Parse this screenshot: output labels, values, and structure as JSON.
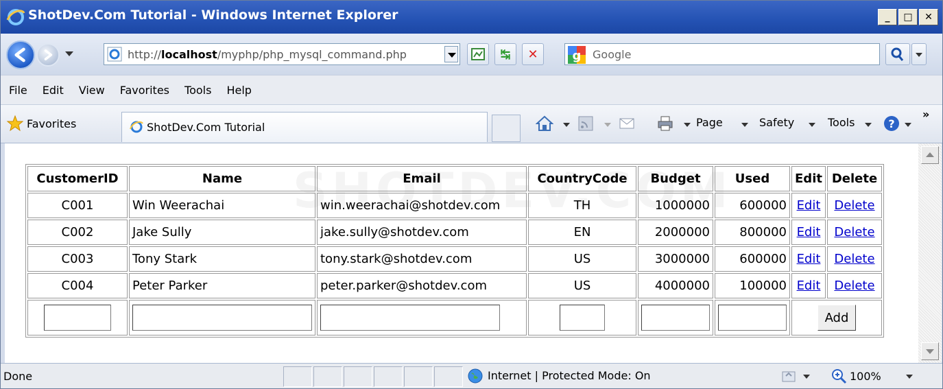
{
  "window": {
    "title": "ShotDev.Com Tutorial - Windows Internet Explorer",
    "controls": [
      "_",
      "□",
      "✕"
    ]
  },
  "address": {
    "prefix": "http://",
    "host": "localhost",
    "path": "/myphp/php_mysql_command.php"
  },
  "search": {
    "placeholder": "Google"
  },
  "menu": [
    "File",
    "Edit",
    "View",
    "Favorites",
    "Tools",
    "Help"
  ],
  "favorites": {
    "label": "Favorites",
    "tab_title": "ShotDev.Com Tutorial"
  },
  "commandbar": {
    "page": "Page",
    "safety": "Safety",
    "tools": "Tools",
    "chevron": "»"
  },
  "table": {
    "headers": [
      "CustomerID",
      "Name",
      "Email",
      "CountryCode",
      "Budget",
      "Used",
      "Edit",
      "Delete"
    ],
    "rows": [
      {
        "id": "C001",
        "name": "Win Weerachai",
        "email": "win.weerachai@shotdev.com",
        "country": "TH",
        "budget": "1000000",
        "used": "600000",
        "edit": "Edit",
        "delete": "Delete"
      },
      {
        "id": "C002",
        "name": "Jake Sully",
        "email": "jake.sully@shotdev.com",
        "country": "EN",
        "budget": "2000000",
        "used": "800000",
        "edit": "Edit",
        "delete": "Delete"
      },
      {
        "id": "C003",
        "name": "Tony Stark",
        "email": "tony.stark@shotdev.com",
        "country": "US",
        "budget": "3000000",
        "used": "600000",
        "edit": "Edit",
        "delete": "Delete"
      },
      {
        "id": "C004",
        "name": "Peter Parker",
        "email": "peter.parker@shotdev.com",
        "country": "US",
        "budget": "4000000",
        "used": "100000",
        "edit": "Edit",
        "delete": "Delete"
      }
    ],
    "add_label": "Add"
  },
  "watermark": "SHOTDEV.COM",
  "status": {
    "text": "Done",
    "zone": "Internet | Protected Mode: On",
    "zoom": "100%"
  }
}
